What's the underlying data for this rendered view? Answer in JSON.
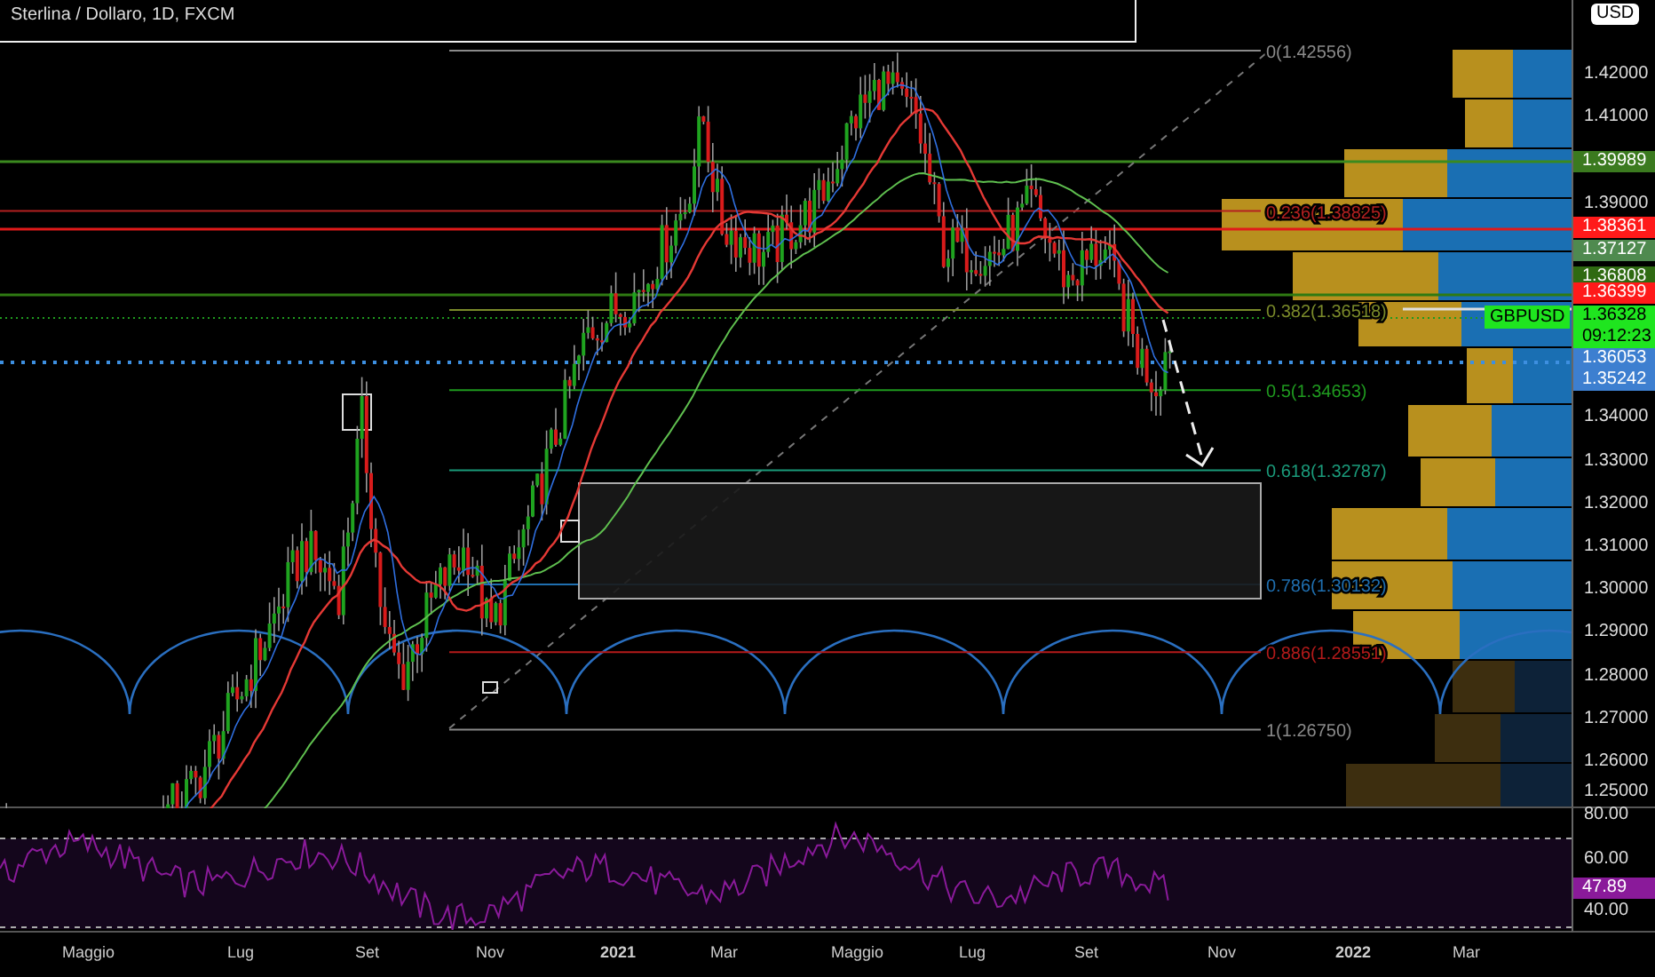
{
  "chart_title": "Sterlina / Dollaro, 1D, FXCM",
  "currency_label": "USD",
  "symbol_tag": "GBPUSD",
  "price_axis": {
    "ticks": [
      "1.42000",
      "1.41000",
      "1.39000",
      "1.34000",
      "1.33000",
      "1.32000",
      "1.31000",
      "1.30000",
      "1.29000",
      "1.28000",
      "1.27000",
      "1.26000",
      "1.25000"
    ],
    "tags": [
      {
        "price": "1.39989",
        "color": "#3b7a1f"
      },
      {
        "price": "1.38361",
        "color": "#ff1a1a"
      },
      {
        "price": "1.37127",
        "color": "#4f8a4f"
      },
      {
        "price": "1.36808",
        "color": "#2f6a12"
      },
      {
        "price": "1.36399",
        "color": "#ff1a1a"
      },
      {
        "price": "1.36053",
        "color": "#3d7fd0"
      },
      {
        "price": "1.35242",
        "color": "#3d7fd0"
      }
    ],
    "last_price": {
      "price": "1.36328",
      "countdown": "09:12:23",
      "color": "#1fe51f"
    }
  },
  "fib_levels": [
    {
      "label": "0(1.42556)",
      "color": "#8a8a8a"
    },
    {
      "label": "0.236(1.38825)",
      "color": "#b32020"
    },
    {
      "label": "0.382(1.36518)",
      "color": "#7a8a2a"
    },
    {
      "label": "0.5(1.34653)",
      "color": "#1f9a1f"
    },
    {
      "label": "0.618(1.32787)",
      "color": "#1a9a7a"
    },
    {
      "label": "0.786(1.30132)",
      "color": "#1f6fb0"
    },
    {
      "label": "0.886(1.28551)",
      "color": "#b31a1a"
    },
    {
      "label": "1(1.26750)",
      "color": "#8a8a8a"
    }
  ],
  "rsi": {
    "ticks": [
      "80.00",
      "60.00",
      "40.00"
    ],
    "value": "47.89",
    "color": "#8a1a9a"
  },
  "time_axis": [
    "Maggio",
    "Lug",
    "Set",
    "Nov",
    "2021",
    "Mar",
    "Maggio",
    "Lug",
    "Set",
    "Nov",
    "2022",
    "Mar"
  ]
}
